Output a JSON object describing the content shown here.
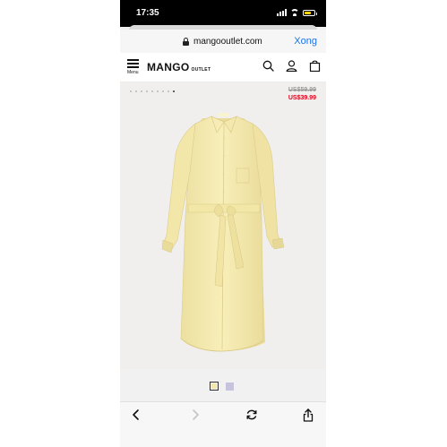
{
  "status_bar": {
    "time": "17:35"
  },
  "browser": {
    "url": "mangooutlet.com",
    "done_label": "Xong"
  },
  "header": {
    "brand": "MANGO",
    "brand_sub": "OUTLET",
    "menu_label": "Menu"
  },
  "product": {
    "price_original": "US$59.99",
    "price_sale": "US$39.99",
    "image_count": 9,
    "active_image_index": 8,
    "colors": [
      "#f3e8a9",
      "#c6c4dd"
    ],
    "selected_color_index": 0
  },
  "icons": {
    "header": [
      "menu-icon",
      "search-icon",
      "account-icon",
      "bag-icon"
    ],
    "toolbar": [
      "back-icon",
      "forward-icon",
      "reload-icon",
      "share-icon"
    ]
  },
  "accent_colors": {
    "link": "#1a73e8",
    "sale": "#e2001a",
    "dress": "#f3e8a9"
  }
}
